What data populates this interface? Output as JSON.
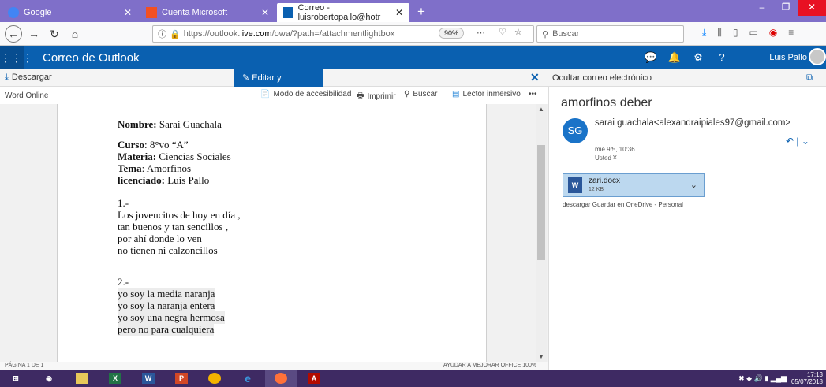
{
  "browser": {
    "tabs": [
      {
        "label": "Google",
        "favicon_color": "#4285f4"
      },
      {
        "label": "Cuenta Microsoft",
        "favicon_color": "#f25022"
      },
      {
        "label": "Correo - luisrobertopallo@hotr",
        "favicon_color": "#0a60b0"
      }
    ],
    "url_prefix": "https://outlook.",
    "url_domain": "live.com",
    "url_path": "/owa/?path=/attachmentlightbox",
    "zoom": "90%",
    "search_placeholder": "Buscar"
  },
  "owa": {
    "title": "Correo de Outlook",
    "user": "Luis Pallo"
  },
  "command_bar": {
    "download": "Descargar",
    "edit_reply": "Editar y responder",
    "hide_mail": "Ocultar correo electrónico"
  },
  "word_toolbar": {
    "app_label": "Word Online",
    "accessibility": "Modo de accesibilidad",
    "print": "Imprimir",
    "find": "Buscar",
    "immersive_reader": "Lector inmersivo"
  },
  "document": {
    "nombre_label": "Nombre:",
    "nombre_value": " Sarai Guachala",
    "curso_label": "Curso",
    "curso_value": ": 8°vo “A”",
    "materia_label": "Materia:",
    "materia_value": " Ciencias Sociales",
    "tema_label": "Tema",
    "tema_value": ": Amorfinos",
    "licenciado_label": "licenciado:",
    "licenciado_value": " Luis Pallo",
    "section1_num": "1.-",
    "section1_lines": [
      "Los jovencitos de hoy en día ,",
      "tan buenos y tan sencillos ,",
      "por ahí donde lo ven",
      "no tienen ni calzoncillos"
    ],
    "section2_num": "2.-",
    "section2_lines": [
      "yo soy la media naranja",
      "yo soy la naranja entera",
      "yo soy una negra hermosa",
      "pero no para cualquiera"
    ]
  },
  "status": {
    "page": "PÁGINA 1 DE 1",
    "help": "AYUDAR A MEJORAR OFFICE   100%"
  },
  "message": {
    "subject": "amorfinos deber",
    "initials": "SG",
    "sender": "sarai guachala<alexandraipiales97@gmail.com>",
    "date": "mié 9/5, 10:36",
    "to": "Usted ¥",
    "attachment_name": "zari.docx",
    "attachment_size": "12 KB",
    "attachment_actions": "descargar   Guardar en OneDrive - Personal"
  },
  "taskbar": {
    "clock_time": "17:13",
    "clock_date": "05/07/2018"
  }
}
